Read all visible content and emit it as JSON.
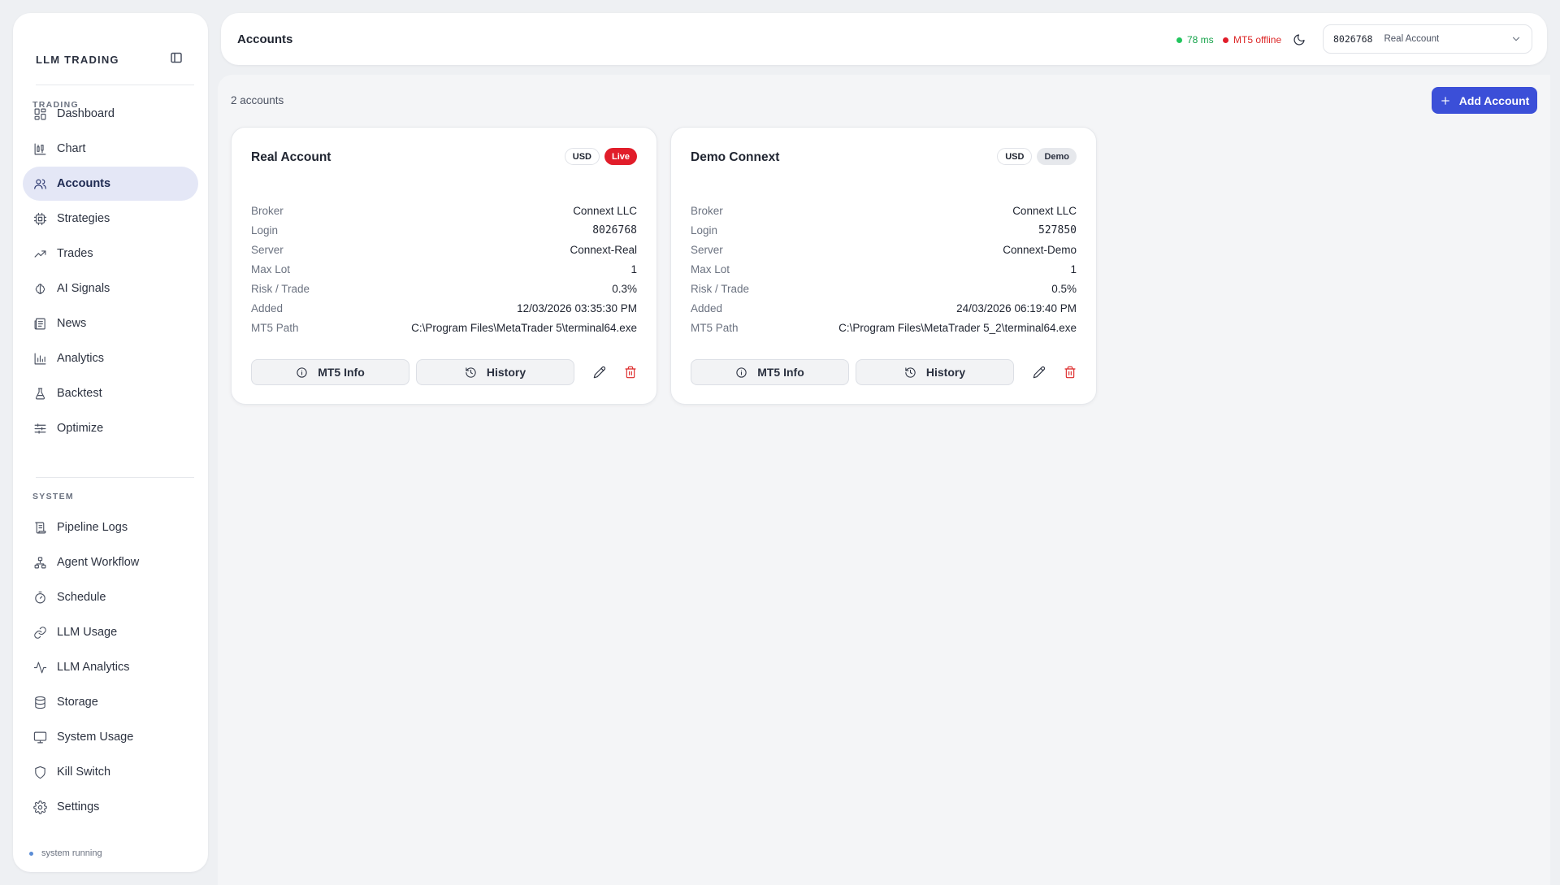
{
  "sidebar": {
    "brand": "LLM TRADING",
    "sections": [
      {
        "label": "TRADING"
      },
      {
        "label": "SYSTEM"
      }
    ],
    "items": [
      {
        "label": "Dashboard",
        "icon": "dashboard-icon"
      },
      {
        "label": "Chart",
        "icon": "chart-icon"
      },
      {
        "label": "Accounts",
        "icon": "users-icon",
        "active": true
      },
      {
        "label": "Strategies",
        "icon": "cpu-icon"
      },
      {
        "label": "Trades",
        "icon": "trending-up-icon"
      },
      {
        "label": "AI Signals",
        "icon": "brain-icon"
      },
      {
        "label": "News",
        "icon": "newspaper-icon"
      },
      {
        "label": "Analytics",
        "icon": "bar-chart-icon"
      },
      {
        "label": "Backtest",
        "icon": "flask-icon"
      },
      {
        "label": "Optimize",
        "icon": "sliders-icon"
      },
      {
        "label": "Pipeline Logs",
        "icon": "scroll-icon"
      },
      {
        "label": "Agent Workflow",
        "icon": "workflow-icon"
      },
      {
        "label": "Schedule",
        "icon": "timer-icon"
      },
      {
        "label": "LLM Usage",
        "icon": "link-icon"
      },
      {
        "label": "LLM Analytics",
        "icon": "activity-icon"
      },
      {
        "label": "Storage",
        "icon": "database-icon"
      },
      {
        "label": "System Usage",
        "icon": "monitor-icon"
      },
      {
        "label": "Kill Switch",
        "icon": "shield-icon"
      },
      {
        "label": "Settings",
        "icon": "gear-icon"
      }
    ],
    "status": "system running"
  },
  "header": {
    "title": "Accounts",
    "latency": "78 ms",
    "mt5_status": "MT5 offline",
    "account_selector": {
      "login": "8026768",
      "name": "Real Account"
    }
  },
  "main": {
    "count_text": "2 accounts",
    "add_button": "Add Account",
    "accounts": [
      {
        "name": "Real Account",
        "currency": "USD",
        "type": "Live",
        "fields": [
          {
            "label": "Broker",
            "value": "Connext LLC"
          },
          {
            "label": "Login",
            "value": "8026768"
          },
          {
            "label": "Server",
            "value": "Connext-Real"
          },
          {
            "label": "Max Lot",
            "value": "1"
          },
          {
            "label": "Risk / Trade",
            "value": "0.3%"
          },
          {
            "label": "Added",
            "value": "12/03/2026 03:35:30 PM"
          },
          {
            "label": "MT5 Path",
            "value": "C:\\Program Files\\MetaTrader 5\\terminal64.exe"
          }
        ],
        "info_button": "MT5 Info",
        "history_button": "History"
      },
      {
        "name": "Demo Connext",
        "currency": "USD",
        "type": "Demo",
        "fields": [
          {
            "label": "Broker",
            "value": "Connext LLC"
          },
          {
            "label": "Login",
            "value": "527850"
          },
          {
            "label": "Server",
            "value": "Connext-Demo"
          },
          {
            "label": "Max Lot",
            "value": "1"
          },
          {
            "label": "Risk / Trade",
            "value": "0.5%"
          },
          {
            "label": "Added",
            "value": "24/03/2026 06:19:40 PM"
          },
          {
            "label": "MT5 Path",
            "value": "C:\\Program Files\\MetaTrader 5_2\\terminal64.exe"
          }
        ],
        "info_button": "MT5 Info",
        "history_button": "History"
      }
    ]
  },
  "colors": {
    "accent": "#3b4fd8",
    "live": "#e11d2a",
    "online": "#16a34a",
    "offline": "#dc2626"
  }
}
